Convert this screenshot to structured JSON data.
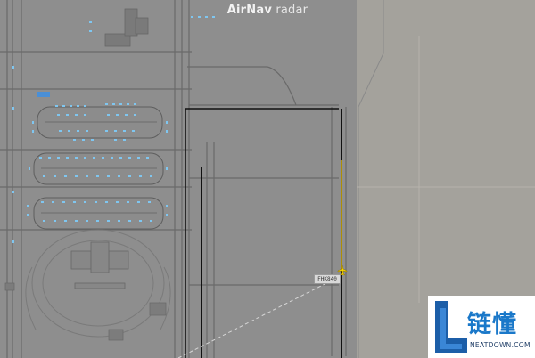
{
  "app": {
    "brand_bold": "AirNav",
    "brand_light": " radar"
  },
  "aircraft": {
    "callsign": "FHK840",
    "label_color": "#d9d9d9",
    "icon_color": "#f5d400"
  },
  "map": {
    "background_color": "#8e8e8e",
    "land_color": "#a4a29c",
    "gate_color": "#7fc6f0",
    "runway_color": "#111111",
    "track_color": "#e2b900"
  },
  "watermark": {
    "chinese": "链懂",
    "english": "NEATDOWN.COM"
  }
}
